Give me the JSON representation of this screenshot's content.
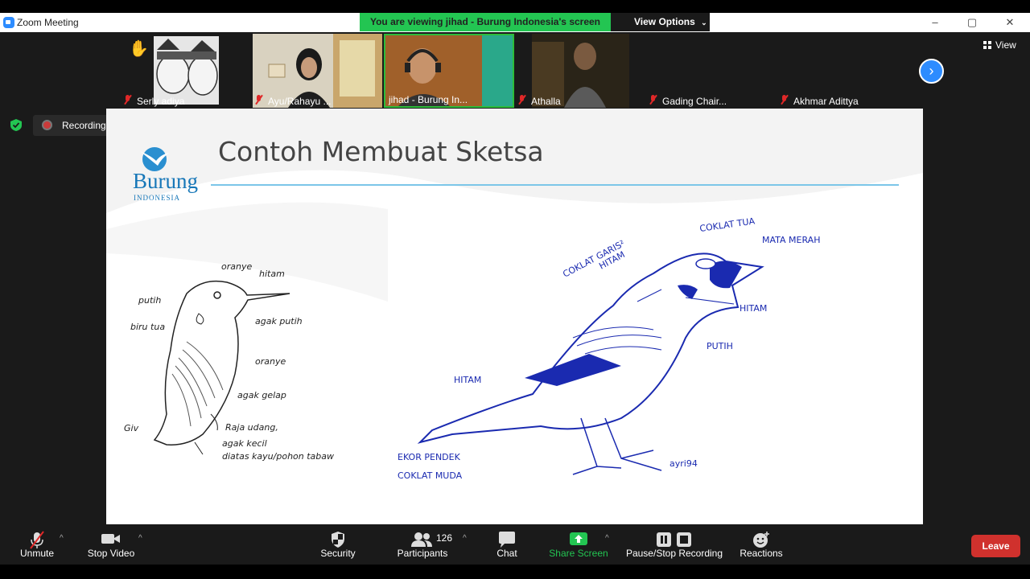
{
  "window": {
    "title": "Zoom Meeting",
    "controls": [
      "–",
      "▢",
      "✕"
    ]
  },
  "share_banner": {
    "text": "You are viewing jihad - Burung Indonesia's screen",
    "view_options_label": "View Options",
    "color": "#23c552"
  },
  "participants_strip": {
    "tiles": [
      {
        "name": "Serly adiya",
        "muted": true
      },
      {
        "name": "Ayu/Rahayu ...",
        "muted": true
      },
      {
        "name": "jihad - Burung In...",
        "muted": false,
        "active_speaker": true
      },
      {
        "name": "Athalla",
        "muted": true
      },
      {
        "name": "Gading Chair...",
        "muted": true
      },
      {
        "name": "Akhmar Adittya",
        "muted": true
      }
    ],
    "view_label": "View",
    "next_icon": "chevron-right-icon"
  },
  "recording": {
    "label": "Recording...",
    "status_color": "#c93a3a"
  },
  "slide": {
    "title": "Contoh Membuat Sketsa",
    "logo": {
      "name": "Burung",
      "sub": "INDONESIA"
    },
    "kingfisher_labels": [
      "oranye",
      "hitam",
      "putih",
      "biru tua",
      "agak putih",
      "oranye",
      "agak gelap",
      "Giv",
      "Raja udang,",
      "agak kecil",
      "diatas kayu/pohon tabaw"
    ],
    "sparrow_labels": [
      "COKLAT GARIS²",
      "HITAM",
      "COKLAT TUA",
      "MATA MERAH",
      "HITAM",
      "PUTIH",
      "HITAM",
      "EKOR PENDEK",
      "COKLAT MUDA",
      "ayri94"
    ]
  },
  "toolbar": {
    "unmute": "Unmute",
    "stop_video": "Stop Video",
    "security": "Security",
    "participants": "Participants",
    "participants_count": "126",
    "chat": "Chat",
    "share_screen": "Share Screen",
    "pause_stop_recording": "Pause/Stop Recording",
    "reactions": "Reactions",
    "leave": "Leave",
    "accent_green": "#23c552",
    "leave_color": "#d0312d"
  }
}
